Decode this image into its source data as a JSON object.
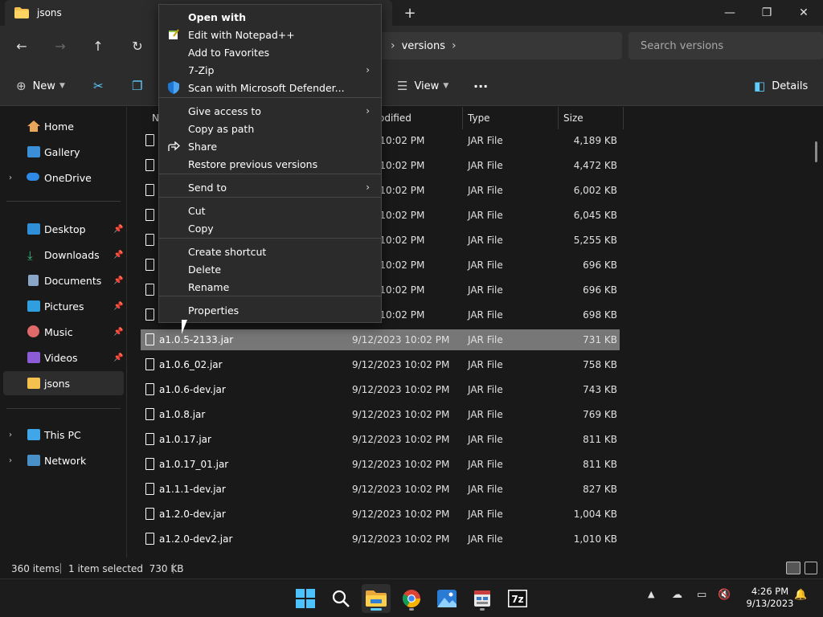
{
  "window": {
    "tab_title": "jsons",
    "new_tab": "+",
    "minimize": "—",
    "maximize": "❐",
    "close": "✕"
  },
  "address": {
    "breadcrumb": [
      "versions"
    ],
    "search_placeholder": "Search versions"
  },
  "commandbar": {
    "new_label": "New",
    "view_label": "View",
    "more_label": "···",
    "details_label": "Details"
  },
  "sidebar": {
    "items": [
      {
        "label": "Home",
        "icon": "home-icon"
      },
      {
        "label": "Gallery",
        "icon": "gallery-icon"
      },
      {
        "label": "OneDrive",
        "icon": "cloud-icon"
      },
      {
        "label": "Desktop",
        "icon": "desktop-icon"
      },
      {
        "label": "Downloads",
        "icon": "download-icon"
      },
      {
        "label": "Documents",
        "icon": "documents-icon"
      },
      {
        "label": "Pictures",
        "icon": "pictures-icon"
      },
      {
        "label": "Music",
        "icon": "music-icon"
      },
      {
        "label": "Videos",
        "icon": "videos-icon"
      },
      {
        "label": "jsons",
        "icon": "folder-icon"
      },
      {
        "label": "This PC",
        "icon": "pc-icon"
      },
      {
        "label": "Network",
        "icon": "network-icon"
      }
    ]
  },
  "columns": {
    "name": "N",
    "modified": "odified",
    "type": "Type",
    "size": "Size"
  },
  "files": [
    {
      "name": "",
      "date": "2023 10:02 PM",
      "type": "JAR File",
      "size": "4,189 KB"
    },
    {
      "name": "",
      "date": "2023 10:02 PM",
      "type": "JAR File",
      "size": "4,472 KB"
    },
    {
      "name": "",
      "date": "2023 10:02 PM",
      "type": "JAR File",
      "size": "6,002 KB"
    },
    {
      "name": "",
      "date": "2023 10:02 PM",
      "type": "JAR File",
      "size": "6,045 KB"
    },
    {
      "name": "",
      "date": "2023 10:02 PM",
      "type": "JAR File",
      "size": "5,255 KB"
    },
    {
      "name": "",
      "date": "2023 10:02 PM",
      "type": "JAR File",
      "size": "696 KB"
    },
    {
      "name": "",
      "date": "2023 10:02 PM",
      "type": "JAR File",
      "size": "696 KB"
    },
    {
      "name": "",
      "date": "2023 10:02 PM",
      "type": "JAR File",
      "size": "698 KB"
    },
    {
      "name": "a1.0.5-2133.jar",
      "date": "9/12/2023 10:02 PM",
      "type": "JAR File",
      "size": "731 KB"
    },
    {
      "name": "a1.0.6_02.jar",
      "date": "9/12/2023 10:02 PM",
      "type": "JAR File",
      "size": "758 KB"
    },
    {
      "name": "a1.0.6-dev.jar",
      "date": "9/12/2023 10:02 PM",
      "type": "JAR File",
      "size": "743 KB"
    },
    {
      "name": "a1.0.8.jar",
      "date": "9/12/2023 10:02 PM",
      "type": "JAR File",
      "size": "769 KB"
    },
    {
      "name": "a1.0.17.jar",
      "date": "9/12/2023 10:02 PM",
      "type": "JAR File",
      "size": "811 KB"
    },
    {
      "name": "a1.0.17_01.jar",
      "date": "9/12/2023 10:02 PM",
      "type": "JAR File",
      "size": "811 KB"
    },
    {
      "name": "a1.1.1-dev.jar",
      "date": "9/12/2023 10:02 PM",
      "type": "JAR File",
      "size": "827 KB"
    },
    {
      "name": "a1.2.0-dev.jar",
      "date": "9/12/2023 10:02 PM",
      "type": "JAR File",
      "size": "1,004 KB"
    },
    {
      "name": "a1.2.0-dev2.jar",
      "date": "9/12/2023 10:02 PM",
      "type": "JAR File",
      "size": "1,010 KB"
    }
  ],
  "selected_row_name": "a1.0.5-2133.jar",
  "context_menu": {
    "items": [
      {
        "label": "Open with",
        "bold": true
      },
      {
        "label": "Edit with Notepad++",
        "icon": "notepadpp-icon"
      },
      {
        "label": "Add to Favorites"
      },
      {
        "label": "7-Zip",
        "submenu": true
      },
      {
        "label": "Scan with Microsoft Defender...",
        "icon": "defender-shield-icon"
      },
      {
        "label": "Give access to",
        "submenu": true
      },
      {
        "label": "Copy as path"
      },
      {
        "label": "Share",
        "icon": "share-icon"
      },
      {
        "label": "Restore previous versions"
      },
      {
        "label": "Send to",
        "submenu": true
      },
      {
        "label": "Cut"
      },
      {
        "label": "Copy"
      },
      {
        "label": "Create shortcut"
      },
      {
        "label": "Delete"
      },
      {
        "label": "Rename"
      },
      {
        "label": "Properties"
      }
    ]
  },
  "status": {
    "count": "360 items",
    "selection": "1 item selected  730 KB"
  },
  "taskbar": {
    "time": "4:26 PM",
    "date": "9/13/2023"
  },
  "colors": {
    "accent": "#60cdff",
    "selected_row": "#777777",
    "menu_bg": "#2b2b2b"
  }
}
